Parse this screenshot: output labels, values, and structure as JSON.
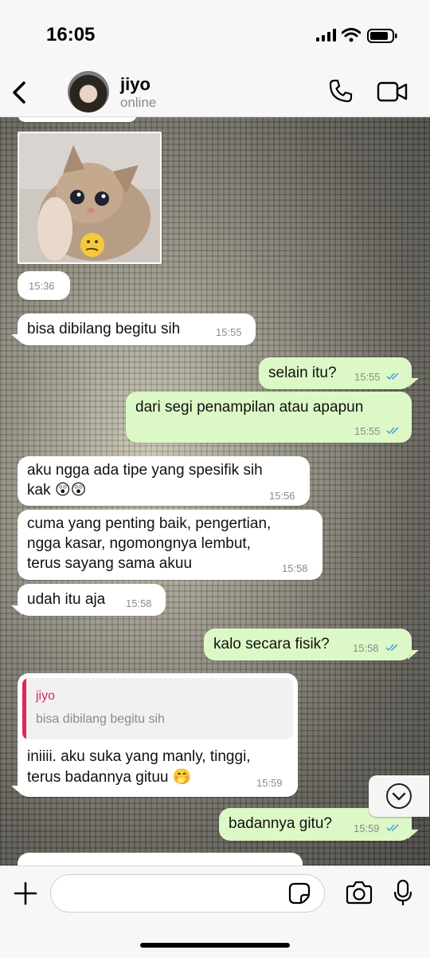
{
  "status_bar": {
    "time": "16:05"
  },
  "header": {
    "contact_name": "jiyo",
    "presence": "online"
  },
  "messages": [
    {
      "dir": "in",
      "type": "image",
      "description": "kitten-thinking-emoji",
      "time": "15:36"
    },
    {
      "dir": "in",
      "lines": [
        "bisa dibilang begitu sih"
      ],
      "time": "15:55"
    },
    {
      "dir": "out",
      "lines": [
        "selain itu?"
      ],
      "time": "15:55",
      "read": true
    },
    {
      "dir": "out",
      "lines": [
        "dari segi penampilan atau apapun"
      ],
      "time": "15:55",
      "read": true
    },
    {
      "dir": "in",
      "lines": [
        "aku ngga ada tipe yang spesifik sih",
        "kak 😲😲"
      ],
      "time": "15:56"
    },
    {
      "dir": "in",
      "lines": [
        "cuma yang penting baik, pengertian,",
        "ngga kasar, ngomongnya lembut,",
        "terus sayang sama akuu"
      ],
      "time": "15:58"
    },
    {
      "dir": "in",
      "lines": [
        "udah itu aja"
      ],
      "time": "15:58"
    },
    {
      "dir": "out",
      "lines": [
        "kalo secara fisik?"
      ],
      "time": "15:58",
      "read": true
    },
    {
      "dir": "in",
      "reply": {
        "author": "jiyo",
        "text": "bisa dibilang begitu sih"
      },
      "lines": [
        "iniiii. aku suka yang manly, tinggi,",
        "terus badannya gituu 🤭"
      ],
      "time": "15:59"
    },
    {
      "dir": "out",
      "lines": [
        "badannya gitu?"
      ],
      "time": "15:59",
      "read": true
    }
  ],
  "colors": {
    "outgoing": "#dcf8c6",
    "incoming": "#ffffff",
    "read_tick": "#4fa3e0",
    "reply_accent": "#e0245e"
  }
}
